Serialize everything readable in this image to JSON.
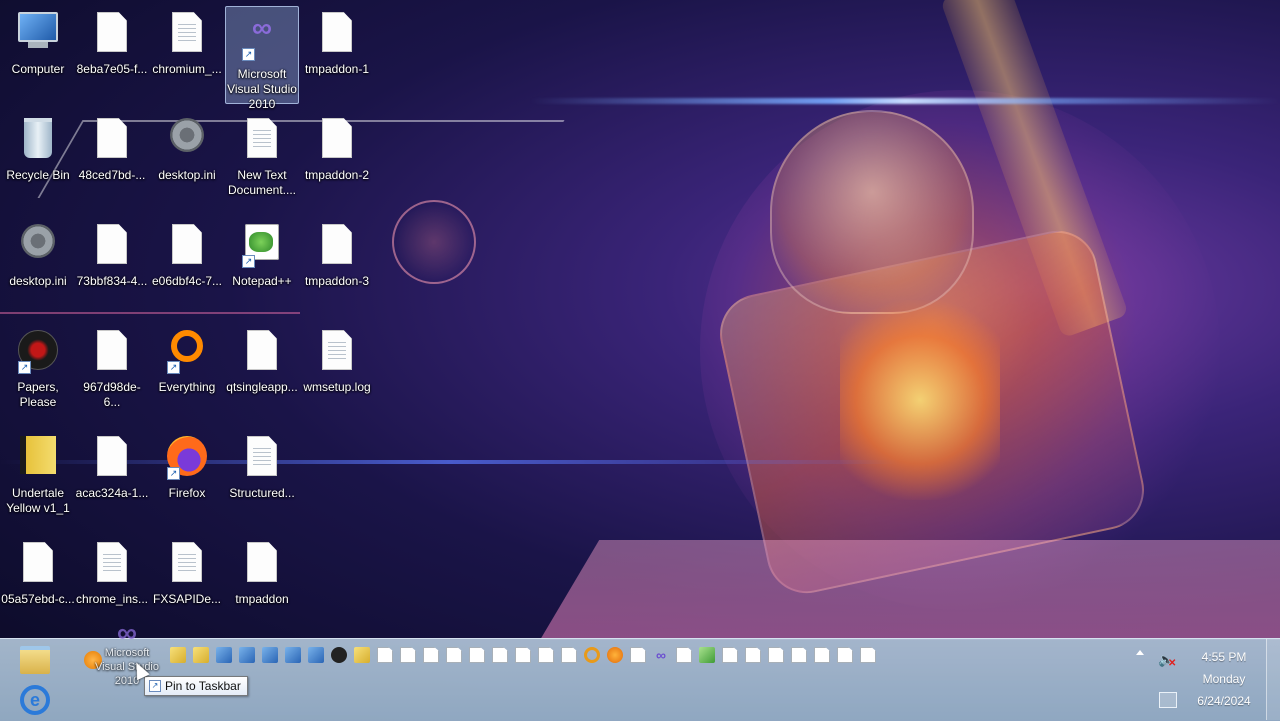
{
  "desktop": {
    "icons": [
      {
        "label": "Computer"
      },
      {
        "label": "8eba7e05-f..."
      },
      {
        "label": "chromium_..."
      },
      {
        "label": "Microsoft Visual Studio 2010"
      },
      {
        "label": "tmpaddon-1"
      },
      {
        "label": "Recycle Bin"
      },
      {
        "label": "48ced7bd-..."
      },
      {
        "label": "desktop.ini"
      },
      {
        "label": "New Text Document...."
      },
      {
        "label": "tmpaddon-2"
      },
      {
        "label": "desktop.ini"
      },
      {
        "label": "73bbf834-4..."
      },
      {
        "label": "e06dbf4c-7..."
      },
      {
        "label": "Notepad++"
      },
      {
        "label": "tmpaddon-3"
      },
      {
        "label": "Papers, Please"
      },
      {
        "label": "967d98de-6..."
      },
      {
        "label": "Everything"
      },
      {
        "label": "qtsingleapp..."
      },
      {
        "label": "wmsetup.log"
      },
      {
        "label": "Undertale Yellow v1_1"
      },
      {
        "label": "acac324a-1..."
      },
      {
        "label": "Firefox"
      },
      {
        "label": "Structured..."
      },
      {
        "label": "05a57ebd-c..."
      },
      {
        "label": "chrome_ins..."
      },
      {
        "label": "FXSAPIDe..."
      },
      {
        "label": "tmpaddon"
      }
    ]
  },
  "taskbar": {
    "drag_ghost_label": "Microsoft Visual Studio 2010",
    "tooltip": "Pin to Taskbar",
    "clock": {
      "time": "4:55 PM",
      "day": "Monday",
      "date": "6/24/2024"
    }
  }
}
